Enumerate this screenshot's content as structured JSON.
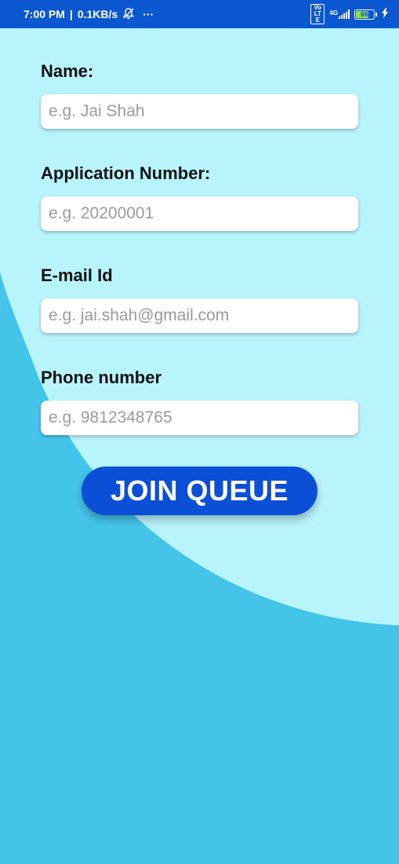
{
  "status_bar": {
    "time": "7:00 PM",
    "speed": "0.1KB/s",
    "mute_icon": "bell-off-icon",
    "more": "···",
    "volte": "Vo LTE",
    "network": "4G",
    "battery_level": "66",
    "charging_icon": "bolt-icon"
  },
  "form": {
    "name_label": "Name:",
    "name_placeholder": "e.g. Jai Shah",
    "app_label": "Application Number:",
    "app_placeholder": "e.g. 20200001",
    "email_label": "E-mail Id",
    "email_placeholder": "e.g. jai.shah@gmail.com",
    "phone_label": "Phone number",
    "phone_placeholder": "e.g. 9812348765"
  },
  "join_button_label": "JOIN QUEUE",
  "colors": {
    "status_bar": "#0b57d0",
    "background_dark": "#45c4ea",
    "background_light": "#b8f4fb",
    "button": "#0b4fd6"
  }
}
